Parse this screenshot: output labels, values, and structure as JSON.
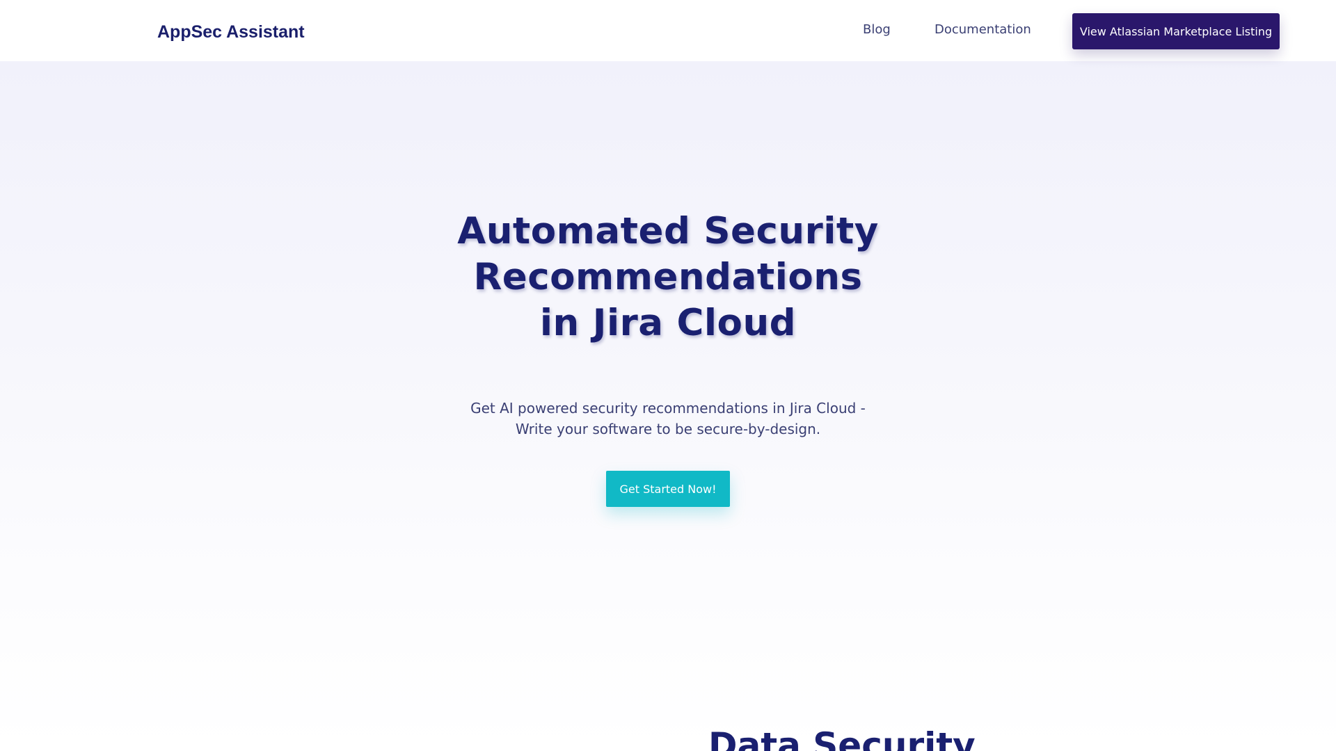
{
  "navbar": {
    "brand": "AppSec Assistant",
    "links": [
      {
        "label": "Blog"
      },
      {
        "label": "Documentation"
      }
    ],
    "marketplace_button": "View Atlassian Marketplace Listing"
  },
  "hero": {
    "title_lines": [
      "Automated Security",
      "Recommendations",
      "in Jira Cloud"
    ],
    "subtitle_lines": [
      "Get AI powered security recommendations in Jira Cloud -",
      "Write your software to be secure-by-design."
    ],
    "cta_label": "Get Started Now!"
  },
  "next_section": {
    "heading": "Data Security"
  },
  "colors": {
    "brand_navy": "#1a2070",
    "marketplace_button": "#2a176b",
    "cta_teal": "#11b9c6",
    "hero_background": "#f1f1fb"
  }
}
